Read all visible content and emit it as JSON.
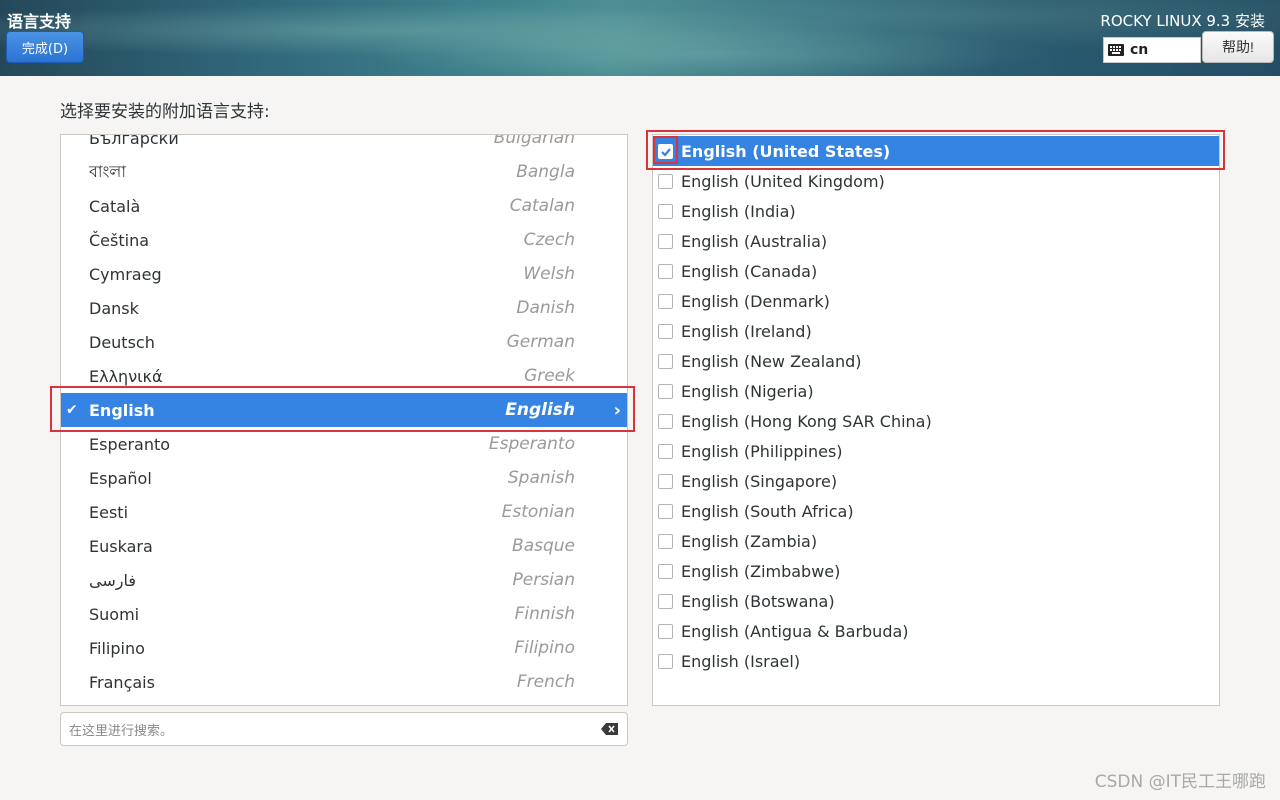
{
  "header": {
    "spoke_title": "语言支持",
    "done_label": "完成(D)",
    "product_title": "ROCKY LINUX 9.3 安装",
    "keyboard_layout": "cn",
    "help_label": "帮助!"
  },
  "prompt": "选择要安装的附加语言支持:",
  "languages": [
    {
      "native": "Български",
      "english": "Bulgarian"
    },
    {
      "native": "বাংলা",
      "english": "Bangla"
    },
    {
      "native": "Català",
      "english": "Catalan"
    },
    {
      "native": "Čeština",
      "english": "Czech"
    },
    {
      "native": "Cymraeg",
      "english": "Welsh"
    },
    {
      "native": "Dansk",
      "english": "Danish"
    },
    {
      "native": "Deutsch",
      "english": "German"
    },
    {
      "native": "Ελληνικά",
      "english": "Greek"
    },
    {
      "native": "English",
      "english": "English",
      "selected": true
    },
    {
      "native": "Esperanto",
      "english": "Esperanto"
    },
    {
      "native": "Español",
      "english": "Spanish"
    },
    {
      "native": "Eesti",
      "english": "Estonian"
    },
    {
      "native": "Euskara",
      "english": "Basque"
    },
    {
      "native": "فارسی",
      "english": "Persian"
    },
    {
      "native": "Suomi",
      "english": "Finnish"
    },
    {
      "native": "Filipino",
      "english": "Filipino"
    },
    {
      "native": "Français",
      "english": "French"
    }
  ],
  "search": {
    "placeholder": "在这里进行搜索。"
  },
  "locales": [
    {
      "label": "English (United States)",
      "checked": true
    },
    {
      "label": "English (United Kingdom)",
      "checked": false
    },
    {
      "label": "English (India)",
      "checked": false
    },
    {
      "label": "English (Australia)",
      "checked": false
    },
    {
      "label": "English (Canada)",
      "checked": false
    },
    {
      "label": "English (Denmark)",
      "checked": false
    },
    {
      "label": "English (Ireland)",
      "checked": false
    },
    {
      "label": "English (New Zealand)",
      "checked": false
    },
    {
      "label": "English (Nigeria)",
      "checked": false
    },
    {
      "label": "English (Hong Kong SAR China)",
      "checked": false
    },
    {
      "label": "English (Philippines)",
      "checked": false
    },
    {
      "label": "English (Singapore)",
      "checked": false
    },
    {
      "label": "English (South Africa)",
      "checked": false
    },
    {
      "label": "English (Zambia)",
      "checked": false
    },
    {
      "label": "English (Zimbabwe)",
      "checked": false
    },
    {
      "label": "English (Botswana)",
      "checked": false
    },
    {
      "label": "English (Antigua & Barbuda)",
      "checked": false
    },
    {
      "label": "English (Israel)",
      "checked": false
    }
  ],
  "watermark": "CSDN @IT民工王哪跑",
  "colors": {
    "selection": "#3584e4",
    "annotation": "#d9343c"
  }
}
